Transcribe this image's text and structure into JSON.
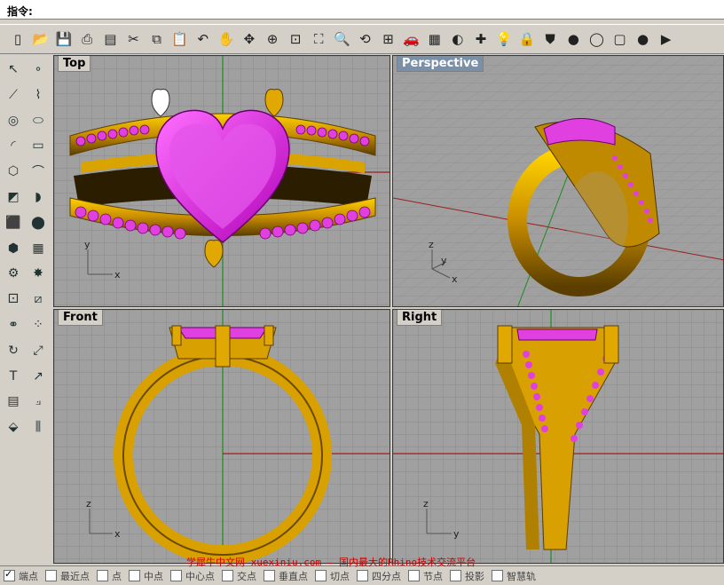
{
  "command": {
    "label": "指令:"
  },
  "toolbar": {
    "icons": [
      {
        "name": "new-file-icon",
        "glyph": "▯"
      },
      {
        "name": "open-folder-icon",
        "glyph": "📂"
      },
      {
        "name": "save-icon",
        "glyph": "💾"
      },
      {
        "name": "print-icon",
        "glyph": "⎙"
      },
      {
        "name": "layout-icon",
        "glyph": "▤"
      },
      {
        "name": "cut-icon",
        "glyph": "✂"
      },
      {
        "name": "copy-icon",
        "glyph": "⧉"
      },
      {
        "name": "paste-icon",
        "glyph": "📋"
      },
      {
        "name": "undo-icon",
        "glyph": "↶"
      },
      {
        "name": "pan-hand-icon",
        "glyph": "✋"
      },
      {
        "name": "rotate-view-icon",
        "glyph": "✥"
      },
      {
        "name": "zoom-icon",
        "glyph": "⊕"
      },
      {
        "name": "zoom-window-icon",
        "glyph": "⊡"
      },
      {
        "name": "zoom-extents-icon",
        "glyph": "⛶"
      },
      {
        "name": "zoom-selected-icon",
        "glyph": "🔍"
      },
      {
        "name": "undo-view-icon",
        "glyph": "⟲"
      },
      {
        "name": "four-viewports-icon",
        "glyph": "⊞"
      },
      {
        "name": "car-icon",
        "glyph": "🚗"
      },
      {
        "name": "grid-snap-icon",
        "glyph": "▦"
      },
      {
        "name": "curve-tools-icon",
        "glyph": "◐"
      },
      {
        "name": "object-snap-icon",
        "glyph": "✚"
      },
      {
        "name": "light-bulb-icon",
        "glyph": "💡"
      },
      {
        "name": "lock-icon",
        "glyph": "🔒"
      },
      {
        "name": "shield-icon",
        "glyph": "⛊"
      },
      {
        "name": "color-wheel-icon",
        "glyph": "●"
      },
      {
        "name": "wireframe-sphere-icon",
        "glyph": "◯"
      },
      {
        "name": "blank-page-icon",
        "glyph": "▢"
      },
      {
        "name": "render-sphere-icon",
        "glyph": "●"
      },
      {
        "name": "more-tools-icon",
        "glyph": "▶"
      }
    ]
  },
  "sidebar": {
    "tools": [
      {
        "name": "select-arrow-icon",
        "glyph": "↖"
      },
      {
        "name": "point-icon",
        "glyph": "∘"
      },
      {
        "name": "polyline-icon",
        "glyph": "⟋"
      },
      {
        "name": "curve-icon",
        "glyph": "⌇"
      },
      {
        "name": "circle-icon",
        "glyph": "◎"
      },
      {
        "name": "ellipse-icon",
        "glyph": "⬭"
      },
      {
        "name": "arc-icon",
        "glyph": "◜"
      },
      {
        "name": "rectangle-icon",
        "glyph": "▭"
      },
      {
        "name": "polygon-icon",
        "glyph": "⬡"
      },
      {
        "name": "fillet-icon",
        "glyph": "⌒"
      },
      {
        "name": "surface-icon",
        "glyph": "◩"
      },
      {
        "name": "surface-edit-icon",
        "glyph": "◗"
      },
      {
        "name": "box-icon",
        "glyph": "⬛"
      },
      {
        "name": "sphere-icon",
        "glyph": "⬤"
      },
      {
        "name": "cylinder-icon",
        "glyph": "⬢"
      },
      {
        "name": "mesh-icon",
        "glyph": "▦"
      },
      {
        "name": "gear-icon",
        "glyph": "⚙"
      },
      {
        "name": "explode-icon",
        "glyph": "✸"
      },
      {
        "name": "boolean-icon",
        "glyph": "⚀"
      },
      {
        "name": "split-icon",
        "glyph": "⧄"
      },
      {
        "name": "group-icon",
        "glyph": "⚭"
      },
      {
        "name": "array-icon",
        "glyph": "⁘"
      },
      {
        "name": "rotate-icon",
        "glyph": "↻"
      },
      {
        "name": "scale-icon",
        "glyph": "⤢"
      },
      {
        "name": "text-icon",
        "glyph": "T"
      },
      {
        "name": "dimension-icon",
        "glyph": "↗"
      },
      {
        "name": "layer-icon",
        "glyph": "▤"
      },
      {
        "name": "analyze-icon",
        "glyph": "⟓"
      },
      {
        "name": "render-icon",
        "glyph": "⬙"
      },
      {
        "name": "line-dimension-icon",
        "glyph": "⫼"
      }
    ]
  },
  "viewports": {
    "top": {
      "label": "Top"
    },
    "perspective": {
      "label": "Perspective"
    },
    "front": {
      "label": "Front"
    },
    "right": {
      "label": "Right"
    }
  },
  "axes": {
    "top": {
      "y": "y",
      "x": "x"
    },
    "perspective": {
      "z": "z",
      "y": "y",
      "x": "x"
    },
    "front": {
      "z": "z",
      "x": "x"
    },
    "right": {
      "z": "z",
      "y": "y"
    }
  },
  "status": {
    "snaps": [
      {
        "label": "端点",
        "checked": true
      },
      {
        "label": "最近点",
        "checked": false
      },
      {
        "label": "点",
        "checked": false
      },
      {
        "label": "中点",
        "checked": false
      },
      {
        "label": "中心点",
        "checked": false
      },
      {
        "label": "交点",
        "checked": false
      },
      {
        "label": "垂直点",
        "checked": false
      },
      {
        "label": "切点",
        "checked": false
      },
      {
        "label": "四分点",
        "checked": false
      },
      {
        "label": "节点",
        "checked": false
      },
      {
        "label": "投影",
        "checked": false
      },
      {
        "label": "智慧轨",
        "checked": false
      }
    ]
  },
  "watermark": {
    "text": "学犀牛中文网 xuexiniu.com — 国内最大的Rhino技术交流平台"
  },
  "colors": {
    "gold": "#e8b400",
    "gold_dark": "#6a4a00",
    "magenta": "#e040e0",
    "viewport_bg": "#a0a0a0",
    "grid": "#8a8a8a"
  }
}
